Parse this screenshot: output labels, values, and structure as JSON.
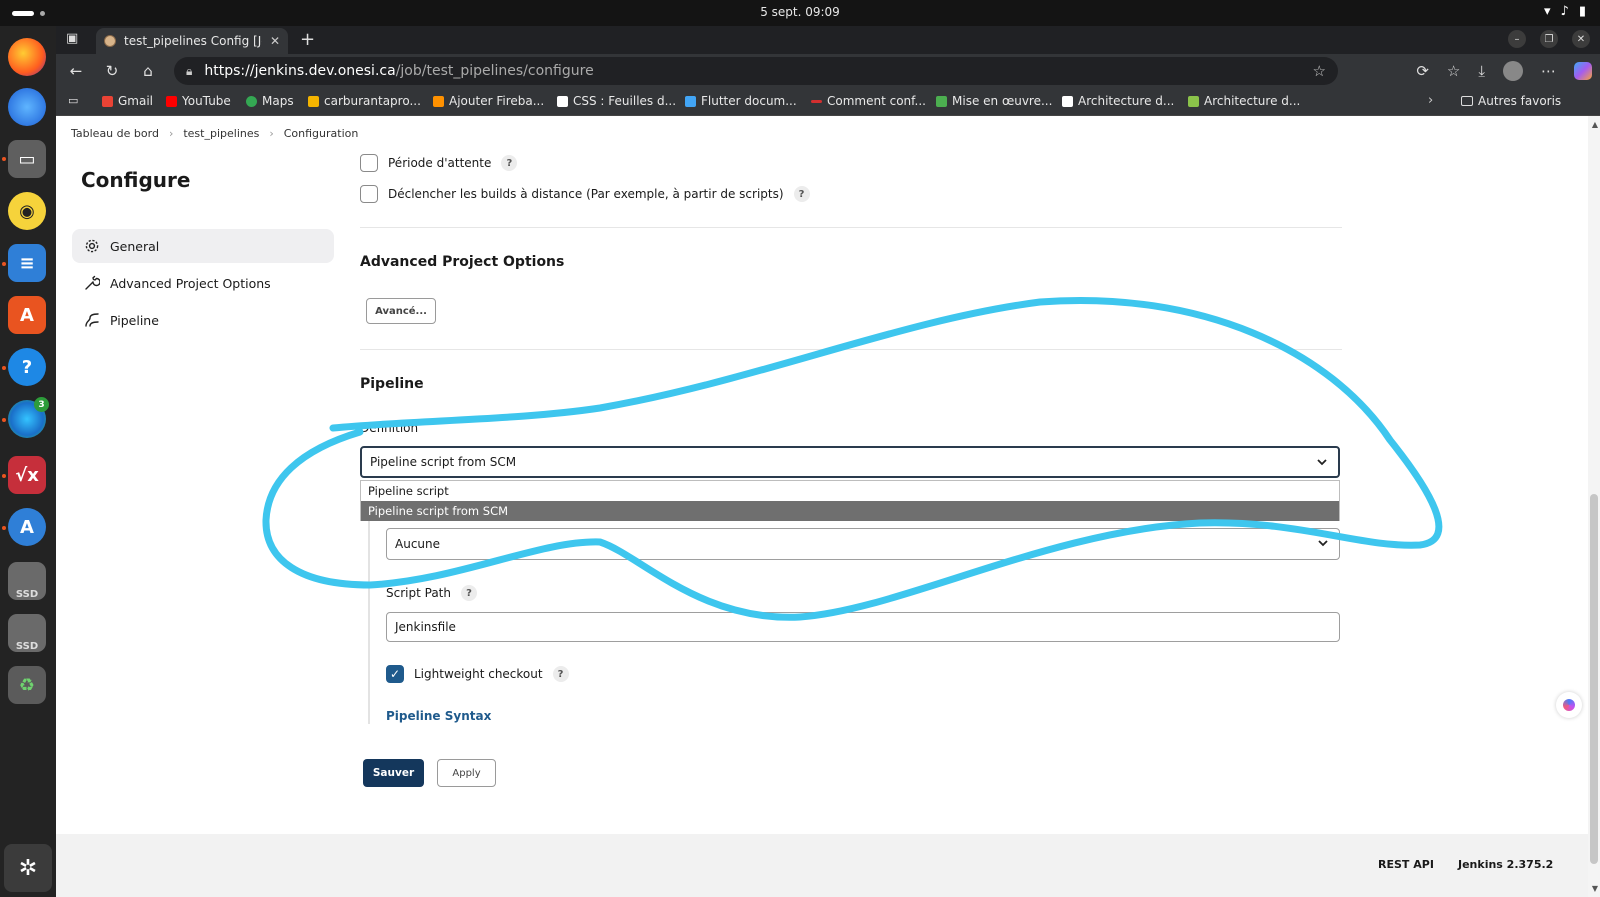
{
  "os": {
    "clock": "5 sept.  09:09",
    "tray": [
      "wifi-icon",
      "volume-icon",
      "battery-icon"
    ]
  },
  "dock": {
    "apps": [
      "firefox",
      "thunderbird",
      "files",
      "rhythmbox",
      "writer",
      "app-center",
      "help",
      "edge",
      "mathcad",
      "software-updater",
      "ssd-drive-1",
      "ssd-drive-2",
      "trash"
    ],
    "edge_badge": "3",
    "ssd_label": "SSD"
  },
  "browser": {
    "tab_title": "test_pipelines Config [Jenkins]",
    "url_host": "https://jenkins.dev.onesi.ca",
    "url_path": "/job/test_pipelines/configure",
    "bookmarks": [
      {
        "label": "Gmail",
        "color": "#ea4335"
      },
      {
        "label": "YouTube",
        "color": "#ff0000"
      },
      {
        "label": "Maps",
        "color": "#34a853"
      },
      {
        "label": "carburantapro...",
        "color": "#f4b400"
      },
      {
        "label": "Ajouter Fireba...",
        "color": "#ff9100"
      },
      {
        "label": "CSS : Feuilles d...",
        "color": "#ffffff"
      },
      {
        "label": "Flutter docum...",
        "color": "#42a5f5"
      },
      {
        "label": "Comment conf...",
        "color": "#d32f2f"
      },
      {
        "label": "Mise en œuvre...",
        "color": "#4caf50"
      },
      {
        "label": "Architecture d...",
        "color": "#ffffff"
      },
      {
        "label": "Architecture d...",
        "color": "#8bc34a"
      }
    ],
    "other_bookmarks": "Autres favoris"
  },
  "jenkins": {
    "breadcrumb": [
      "Tableau de bord",
      "test_pipelines",
      "Configuration"
    ],
    "page_title": "Configure",
    "side_nav": [
      {
        "label": "General",
        "icon": "gear-icon",
        "active": true
      },
      {
        "label": "Advanced Project Options",
        "icon": "wrench-icon",
        "active": false
      },
      {
        "label": "Pipeline",
        "icon": "pipeline-icon",
        "active": false
      }
    ],
    "triggers": {
      "quiet_period": "Période d'attente",
      "remote_trigger": "Déclencher les builds à distance (Par exemple, à partir de scripts)"
    },
    "advanced": {
      "title": "Advanced Project Options",
      "button": "Avancé..."
    },
    "pipeline": {
      "title": "Pipeline",
      "definition_label": "Definition",
      "definition_value": "Pipeline script from SCM",
      "definition_options": [
        "Pipeline script",
        "Pipeline script from SCM"
      ],
      "scm_value": "Aucune",
      "script_path_label": "Script Path",
      "script_path_value": "Jenkinsfile",
      "lightweight_label": "Lightweight checkout",
      "lightweight_checked": true,
      "syntax_link": "Pipeline Syntax"
    },
    "actions": {
      "save": "Sauver",
      "apply": "Apply"
    },
    "footer": {
      "rest_api": "REST API",
      "version": "Jenkins 2.375.2"
    }
  },
  "colors": {
    "primary_button": "#14375c",
    "link": "#1f5a8c",
    "annotation_stroke": "#3ec6ee"
  }
}
